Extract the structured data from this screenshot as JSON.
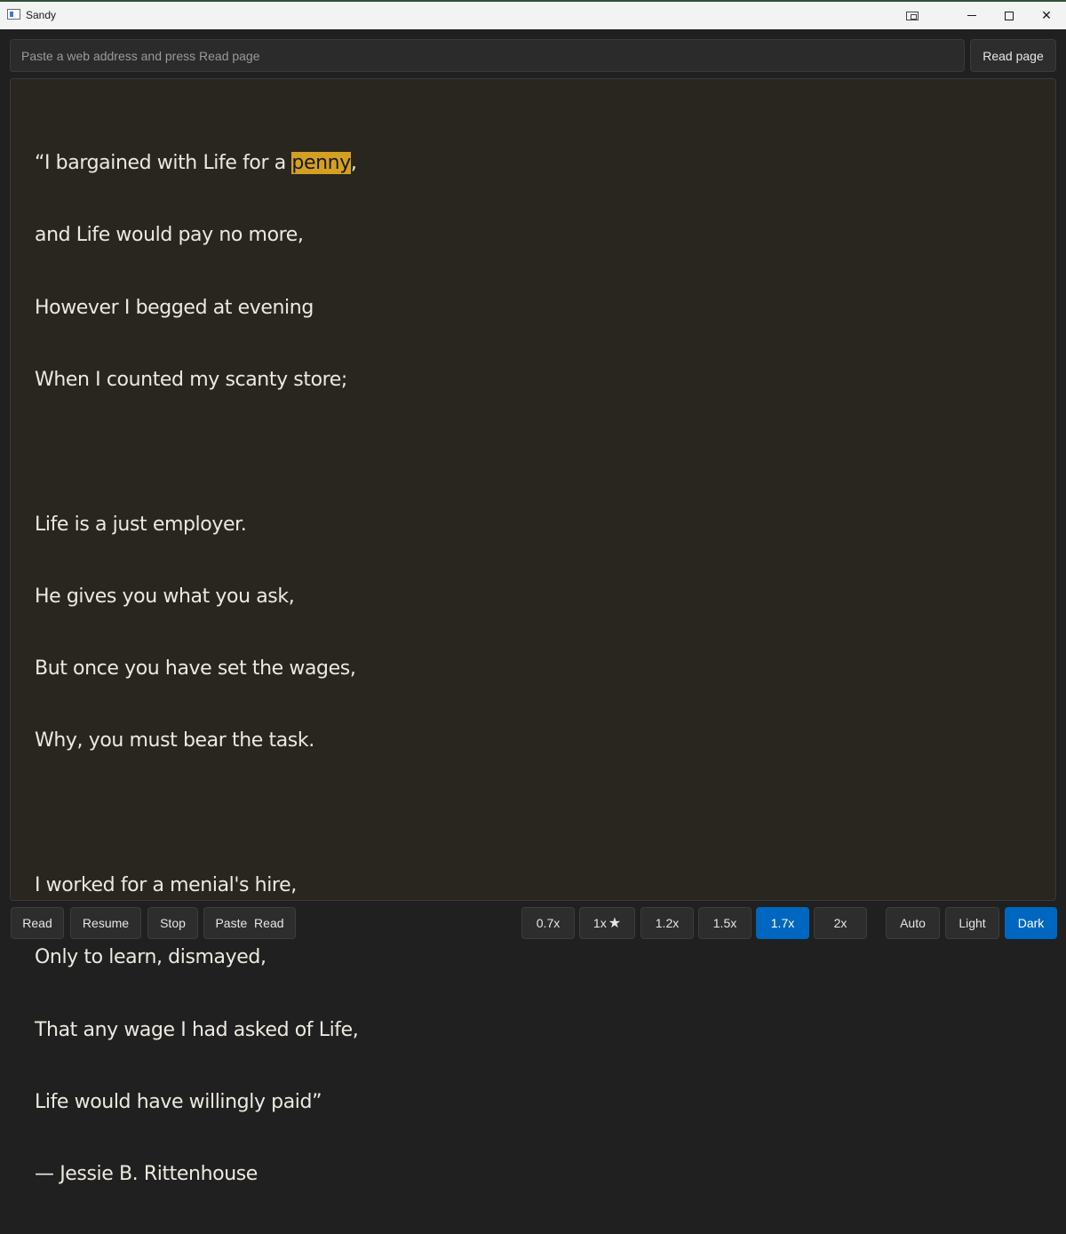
{
  "window": {
    "title": "Sandy"
  },
  "address_bar": {
    "value": "",
    "placeholder": "Paste a web address and press Read page",
    "read_page_label": "Read page"
  },
  "reader": {
    "highlighted_word": "penny",
    "lines": [
      "“I bargained with Life for a ",
      "and Life would pay no more,",
      "However I begged at evening",
      "When I counted my scanty store;",
      "",
      "Life is a just employer.",
      "He gives you what you ask,",
      "But once you have set the wages,",
      "Why, you must bear the task.",
      "",
      "I worked for a menial's hire,",
      "Only to learn, dismayed,",
      "That any wage I had asked of Life,",
      "Life would have willingly paid”",
      "— Jessie B. Rittenhouse"
    ],
    "first_line_after_highlight": ","
  },
  "controls": {
    "read": "Read",
    "resume": "Resume",
    "stop": "Stop",
    "paste_read": "Paste  Read"
  },
  "speeds": {
    "s07": "0.7x",
    "s1": "1x",
    "s12": "1.2x",
    "s15": "1.5x",
    "s17": "1.7x",
    "s2": "2x",
    "selected": "1.7x",
    "default_marker_icon": "star-icon"
  },
  "themes": {
    "auto": "Auto",
    "light": "Light",
    "dark": "Dark",
    "selected": "Dark"
  },
  "colors": {
    "accent": "#0067c0",
    "highlight": "#d4a021",
    "reader_bg": "#29261f"
  }
}
